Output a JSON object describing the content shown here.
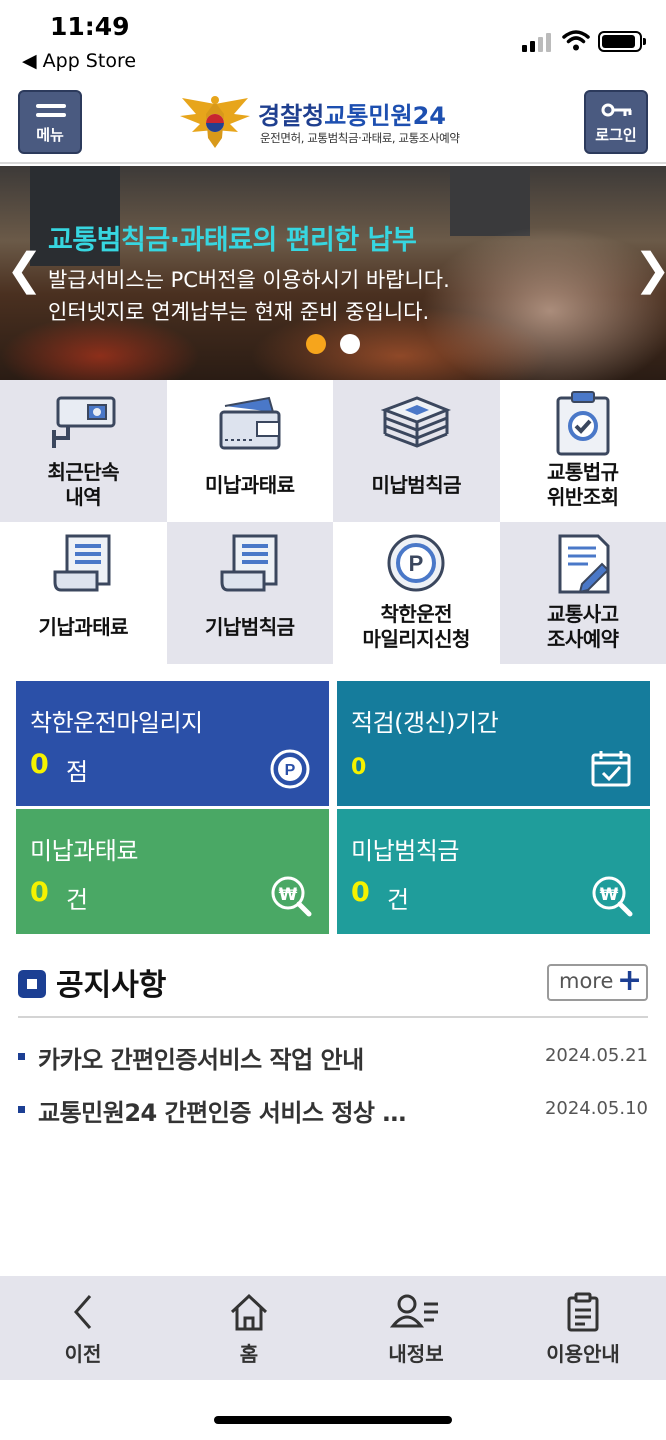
{
  "status_bar": {
    "time": "11:49",
    "back_app": "◀ App Store"
  },
  "header": {
    "menu_label": "메뉴",
    "login_label": "로그인",
    "logo_title_a": "경찰청",
    "logo_title_b": "교통민원24",
    "logo_sub": "운전면허, 교통범칙금·과태료, 교통조사예약"
  },
  "banner": {
    "title": "교통범칙금·과태료의 편리한 납부",
    "line1": "발급서비스는 PC버전을 이용하시기 바랍니다.",
    "line2": "인터넷지로 연계납부는 현재 준비 중입니다.",
    "active_slide": 1,
    "slide_count": 2,
    "dot_colors": [
      "#f6a51c",
      "#ffffff"
    ]
  },
  "menu_grid": [
    {
      "label": "최근단속\n내역",
      "icon": "cctv-camera-icon"
    },
    {
      "label": "미납과태료",
      "icon": "wallet-icon"
    },
    {
      "label": "미납범칙금",
      "icon": "money-stack-icon"
    },
    {
      "label": "교통법규\n위반조회",
      "icon": "clipboard-check-icon"
    },
    {
      "label": "기납과태료",
      "icon": "receipt-scroll-icon"
    },
    {
      "label": "기납범칙금",
      "icon": "receipt-scroll-icon"
    },
    {
      "label": "착한운전\n마일리지신청",
      "icon": "parking-coin-icon"
    },
    {
      "label": "교통사고\n조사예약",
      "icon": "document-pen-icon"
    }
  ],
  "cards": [
    {
      "title": "착한운전마일리지",
      "value": "0",
      "unit": "점",
      "icon": "parking-coin-icon",
      "color": "#2b50a8"
    },
    {
      "title": "적검(갱신)기간",
      "value": "0",
      "unit": "",
      "icon": "calendar-check-icon",
      "color": "#157c9c"
    },
    {
      "title": "미납과태료",
      "value": "0",
      "unit": "건",
      "icon": "won-search-icon",
      "color": "#4aa865"
    },
    {
      "title": "미납범칙금",
      "value": "0",
      "unit": "건",
      "icon": "won-search-icon",
      "color": "#1f9d9b"
    }
  ],
  "notice": {
    "title": "공지사항",
    "more_label": "more",
    "items": [
      {
        "text": "카카오 간편인증서비스 작업 안내",
        "date": "2024.05.21"
      },
      {
        "text": "교통민원24 간편인증 서비스 정상 …",
        "date": "2024.05.10"
      }
    ]
  },
  "bottom_nav": [
    {
      "label": "이전",
      "icon": "chevron-left-icon"
    },
    {
      "label": "홈",
      "icon": "home-icon"
    },
    {
      "label": "내정보",
      "icon": "user-list-icon"
    },
    {
      "label": "이용안내",
      "icon": "clipboard-guide-icon"
    }
  ]
}
